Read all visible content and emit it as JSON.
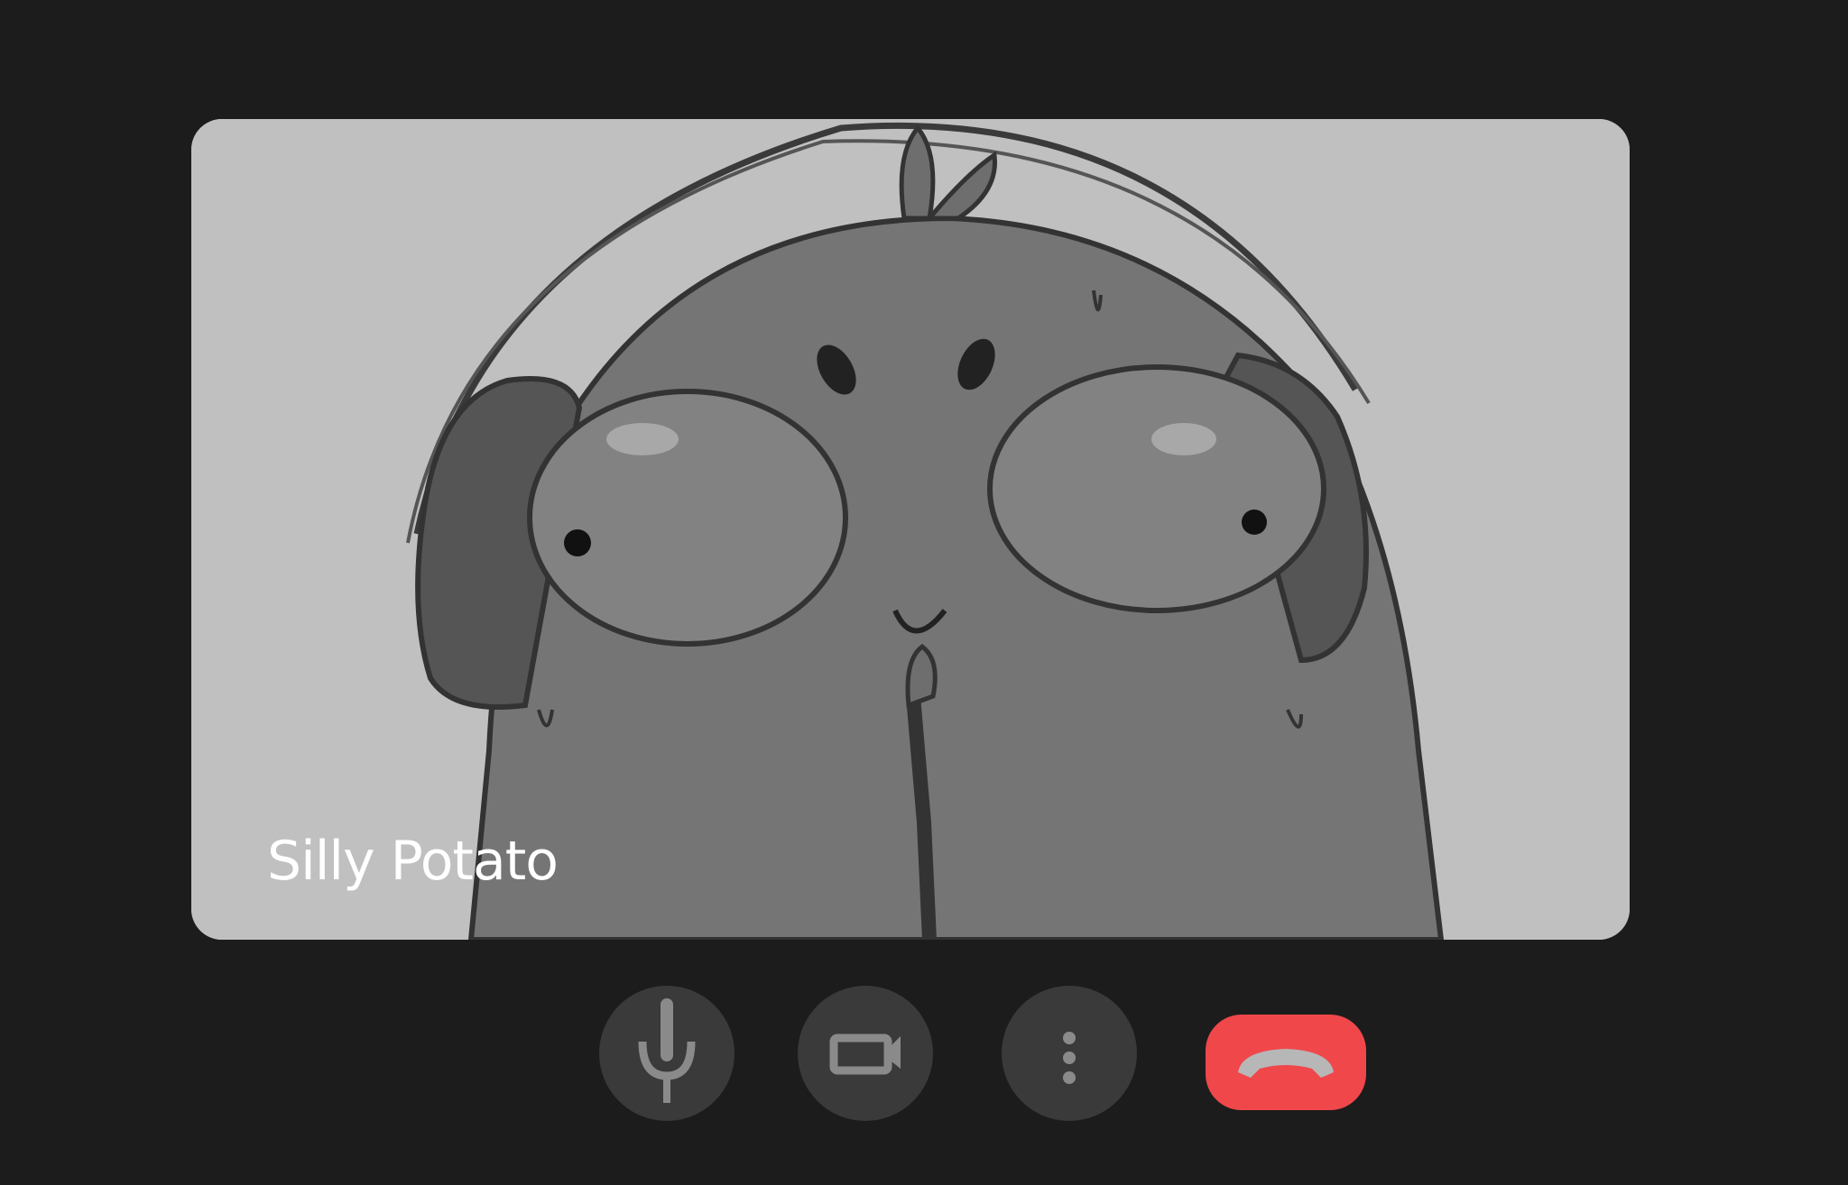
{
  "call": {
    "participant_name": "Silly Potato"
  },
  "controls": {
    "mic_icon": "microphone-icon",
    "camera_icon": "video-camera-icon",
    "more_icon": "more-vertical-icon",
    "hangup_icon": "phone-hangup-icon",
    "hangup_color": "#f0474b",
    "button_color": "#3a3a3a"
  },
  "theme": {
    "background": "#1c1c1c",
    "video_background": "#c0c0c0"
  }
}
